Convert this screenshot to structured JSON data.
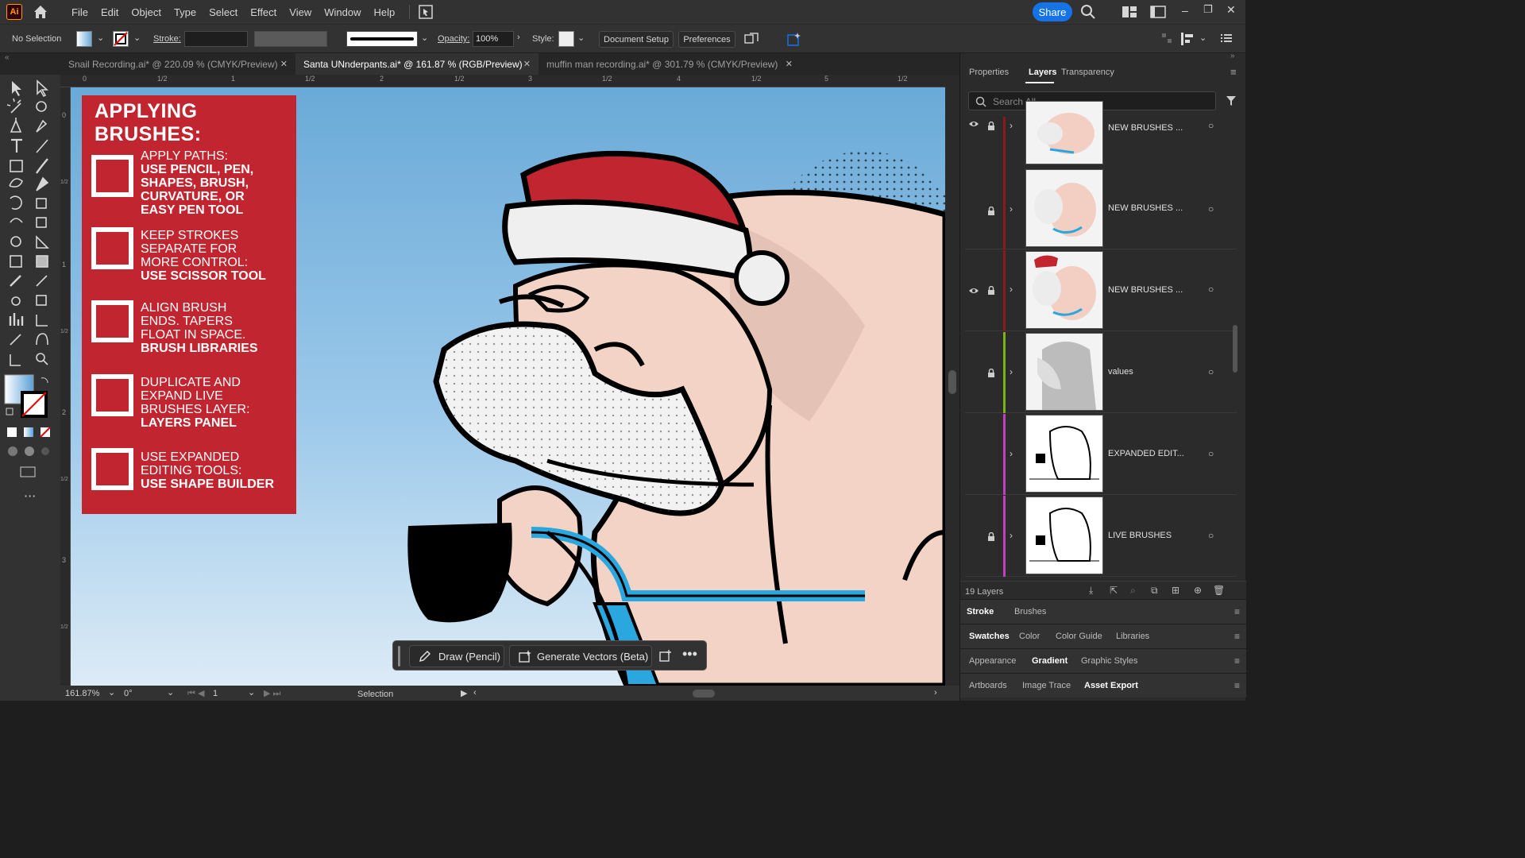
{
  "app": {
    "logo": "Ai"
  },
  "menu": [
    "File",
    "Edit",
    "Object",
    "Type",
    "Select",
    "Effect",
    "View",
    "Window",
    "Help"
  ],
  "share_label": "Share",
  "control": {
    "selection": "No Selection",
    "stroke_label": "Stroke:",
    "opacity_label": "Opacity:",
    "opacity_value": "100%",
    "style_label": "Style:",
    "document_setup": "Document Setup",
    "preferences": "Preferences"
  },
  "tabs": [
    {
      "label": "Snail Recording.ai* @ 220.09 % (CMYK/Preview)",
      "active": false
    },
    {
      "label": "Santa UNnderpants.ai* @ 161.87 % (RGB/Preview)",
      "active": true
    },
    {
      "label": "muffin man recording.ai* @ 301.79 % (CMYK/Preview)",
      "active": false
    }
  ],
  "ruler": {
    "h": [
      "0",
      "1/2",
      "1",
      "1/2",
      "2",
      "1/2",
      "3",
      "1/2",
      "4",
      "1/2",
      "5",
      "1/2"
    ],
    "v": [
      "0",
      "1/2",
      "1",
      "1/2",
      "2",
      "1/2",
      "3",
      "1/2"
    ]
  },
  "info_panel": {
    "title_line1": "APPLYING",
    "title_line2": "BRUSHES:",
    "items": [
      {
        "light": [
          "APPLY PATHS:"
        ],
        "bold": [
          "USE PENCIL, PEN,",
          "SHAPES, BRUSH,",
          "CURVATURE, OR",
          "EASY PEN TOOL"
        ]
      },
      {
        "light": [
          "KEEP STROKES",
          "SEPARATE FOR",
          "MORE CONTROL:"
        ],
        "bold": [
          "USE SCISSOR TOOL"
        ]
      },
      {
        "light": [
          "ALIGN BRUSH",
          "ENDS. TAPERS",
          "FLOAT IN SPACE."
        ],
        "bold": [
          "BRUSH LIBRARIES"
        ]
      },
      {
        "light": [
          "DUPLICATE AND",
          "EXPAND LIVE",
          "BRUSHES LAYER:"
        ],
        "bold": [
          "LAYERS PANEL"
        ]
      },
      {
        "light": [
          "USE EXPANDED",
          "EDITING TOOLS:"
        ],
        "bold": [
          "USE SHAPE BUILDER"
        ]
      }
    ]
  },
  "panel_tabs": [
    {
      "label": "Properties",
      "active": false
    },
    {
      "label": "Layers",
      "active": true
    },
    {
      "label": "Transparency",
      "active": false
    }
  ],
  "search_placeholder": "Search All",
  "layers": [
    {
      "name": "NEW BRUSHES ...",
      "color": "#8b1a1a",
      "visible": true
    },
    {
      "name": "NEW BRUSHES ...",
      "color": "#8b1a1a",
      "visible": false
    },
    {
      "name": "NEW BRUSHES ...",
      "color": "#8b1a1a",
      "visible": true
    },
    {
      "name": "values",
      "color": "#7ab317",
      "visible": false
    },
    {
      "name": "EXPANDED EDIT...",
      "color": "#c040c0",
      "visible": false
    },
    {
      "name": "LIVE BRUSHES",
      "color": "#c040c0",
      "visible": false
    }
  ],
  "layers_count": "19 Layers",
  "panel_groups": [
    {
      "tabs": [
        "Stroke",
        "Brushes"
      ],
      "active": "Stroke"
    },
    {
      "tabs": [
        "Swatches",
        "Color",
        "Color Guide",
        "Libraries"
      ],
      "active": "Swatches"
    },
    {
      "tabs": [
        "Appearance",
        "Gradient",
        "Graphic Styles"
      ],
      "active": "Gradient"
    },
    {
      "tabs": [
        "Artboards",
        "Image Trace",
        "Asset Export"
      ],
      "active": "Asset Export"
    }
  ],
  "status": {
    "zoom": "161.87%",
    "rotation": "0°",
    "artboard": "1",
    "tool": "Selection"
  },
  "context_bar": {
    "draw": "Draw (Pencil)",
    "generate": "Generate Vectors (Beta)"
  },
  "colors": {
    "accent": "#1473e6",
    "panel_red": "#c1252f",
    "sky": "#6aaad8",
    "skin": "#f2d3c6"
  }
}
